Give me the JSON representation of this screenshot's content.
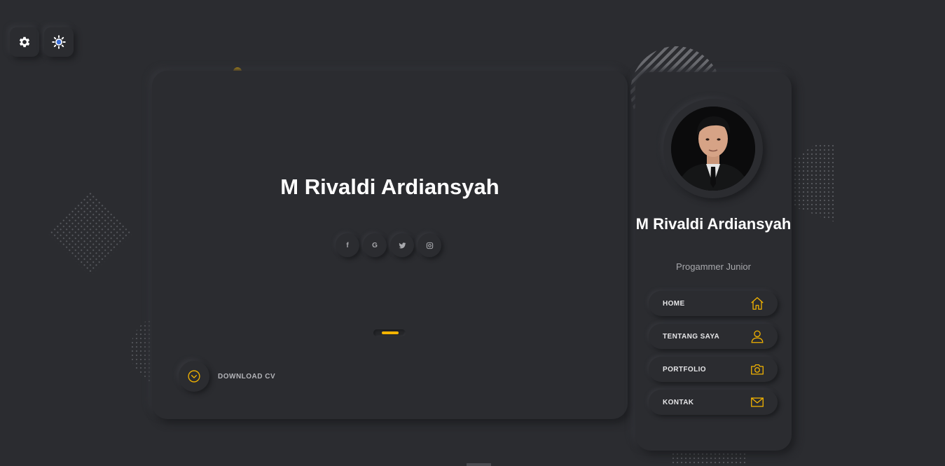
{
  "main": {
    "name": "M Rivaldi Ardiansyah",
    "socials": [
      {
        "icon": "facebook-icon",
        "glyph": "f"
      },
      {
        "icon": "google-icon",
        "glyph": "G"
      },
      {
        "icon": "twitter-icon",
        "glyph": ""
      },
      {
        "icon": "instagram-icon",
        "glyph": ""
      }
    ],
    "download_label": "DOWNLOAD CV"
  },
  "profile": {
    "name": "M Rivaldi Ardiansyah",
    "role": "Progammer Junior"
  },
  "nav": {
    "items": [
      {
        "label": "HOME",
        "icon": "home-icon"
      },
      {
        "label": "TENTANG SAYA",
        "icon": "user-icon"
      },
      {
        "label": "PORTFOLIO",
        "icon": "camera-icon"
      },
      {
        "label": "KONTAK",
        "icon": "mail-icon"
      }
    ]
  },
  "colors": {
    "background": "#2b2c30",
    "accent": "#f4b400",
    "text": "#ffffff",
    "muted": "#a8a9ad"
  }
}
